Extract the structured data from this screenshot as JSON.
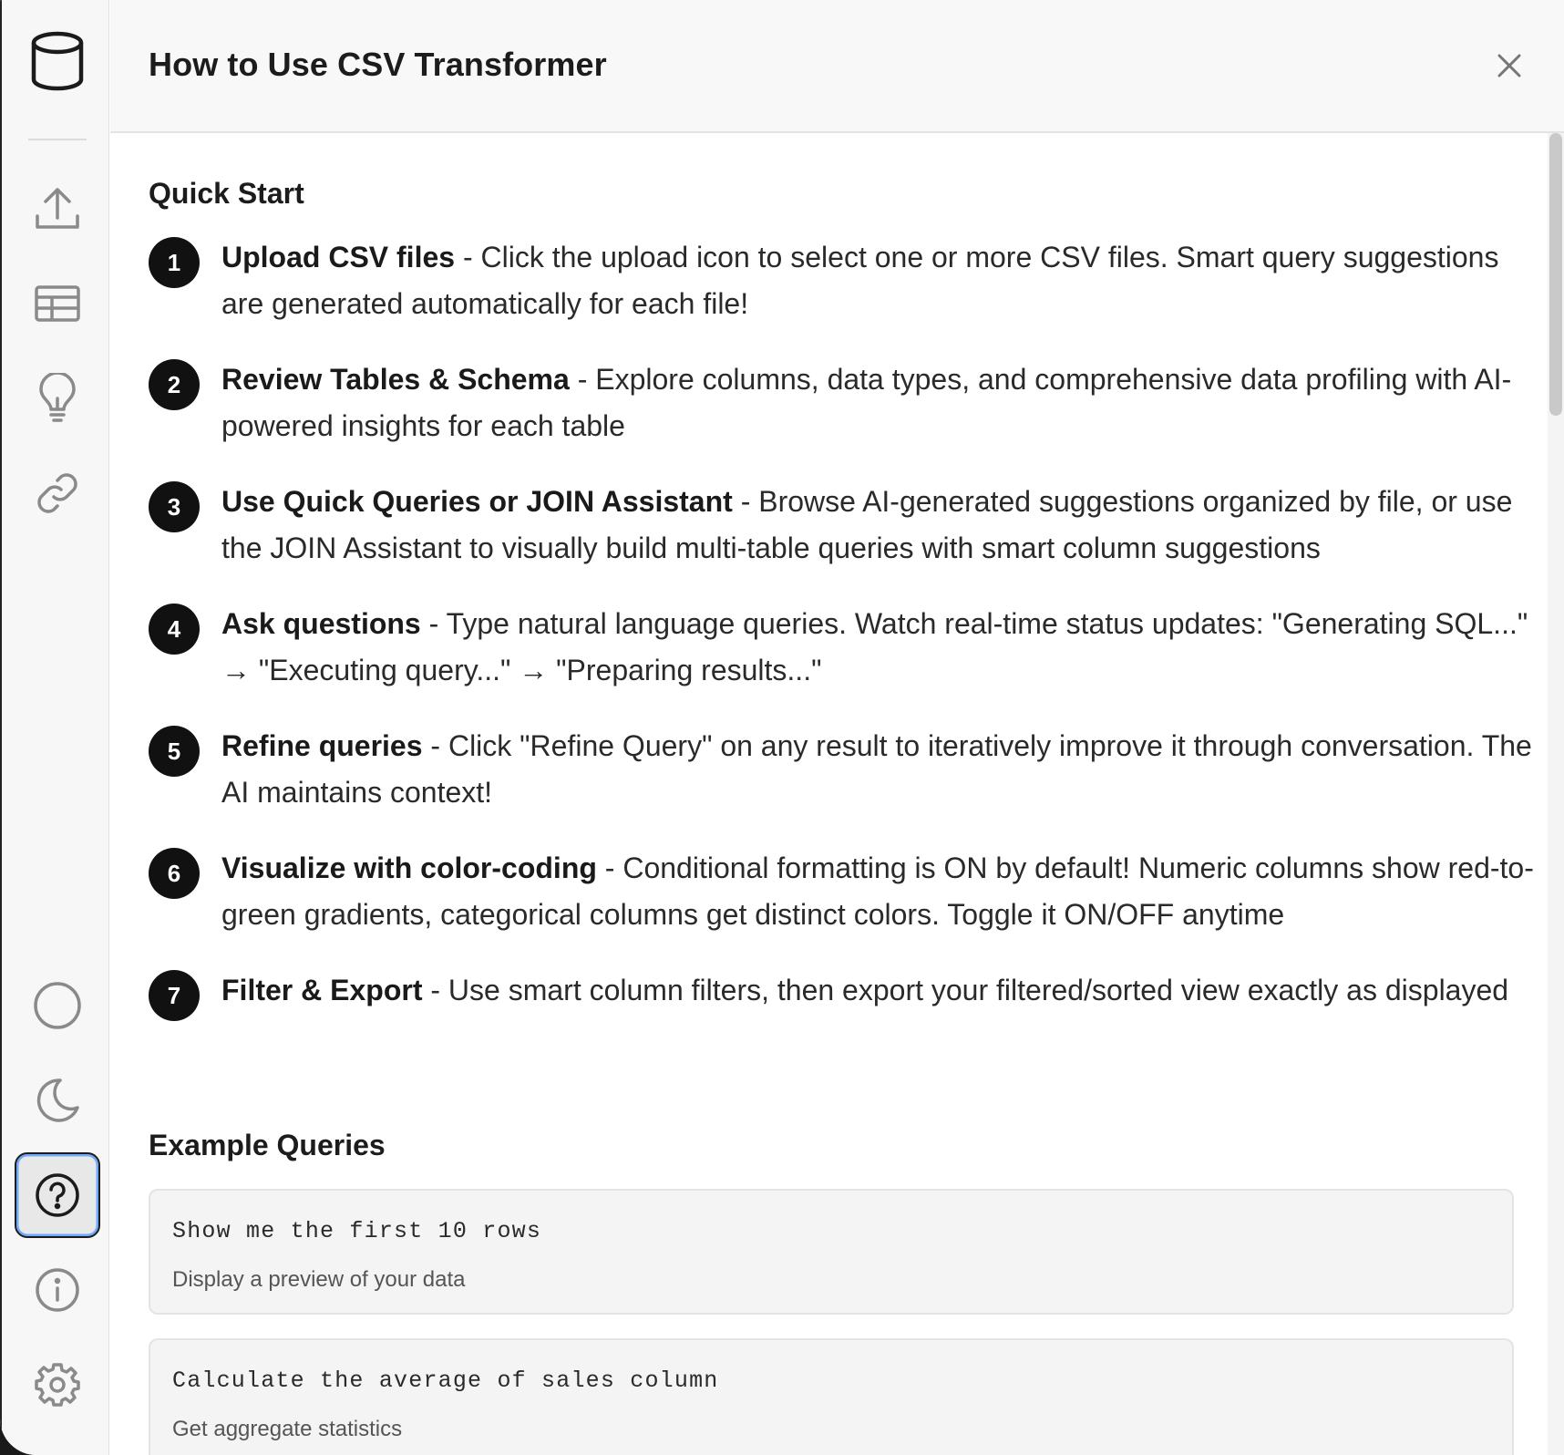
{
  "header": {
    "title": "How to Use CSV Transformer"
  },
  "sidebar": {
    "logo_icon": "database-icon",
    "items": [
      {
        "name": "upload-icon"
      },
      {
        "name": "table-icon"
      },
      {
        "name": "lightbulb-icon"
      },
      {
        "name": "link-icon"
      },
      {
        "name": "circle-icon"
      },
      {
        "name": "moon-icon"
      },
      {
        "name": "help-icon",
        "active": true
      },
      {
        "name": "info-icon"
      },
      {
        "name": "gear-icon"
      }
    ]
  },
  "quick_start": {
    "title": "Quick Start",
    "steps": [
      {
        "num": "1",
        "bold": "Upload CSV files",
        "text": " - Click the upload icon to select one or more CSV files. Smart query suggestions are generated automatically for each file!"
      },
      {
        "num": "2",
        "bold": "Review Tables & Schema",
        "text": " - Explore columns, data types, and comprehensive data profiling with AI-powered insights for each table"
      },
      {
        "num": "3",
        "bold": "Use Quick Queries or JOIN Assistant",
        "text": " - Browse AI-generated suggestions organized by file, or use the JOIN Assistant to visually build multi-table queries with smart column suggestions"
      },
      {
        "num": "4",
        "bold": "Ask questions",
        "text": " - Type natural language queries. Watch real-time status updates: \"Generating SQL...\" → \"Executing query...\" → \"Preparing results...\""
      },
      {
        "num": "5",
        "bold": "Refine queries",
        "text": " - Click \"Refine Query\" on any result to iteratively improve it through conversation. The AI maintains context!"
      },
      {
        "num": "6",
        "bold": "Visualize with color-coding",
        "text": " - Conditional formatting is ON by default! Numeric columns show red-to-green gradients, categorical columns get distinct colors. Toggle it ON/OFF anytime"
      },
      {
        "num": "7",
        "bold": "Filter & Export",
        "text": " - Use smart column filters, then export your filtered/sorted view exactly as displayed"
      }
    ]
  },
  "examples": {
    "title": "Example Queries",
    "items": [
      {
        "query": "Show me the first 10 rows",
        "desc": "Display a preview of your data"
      },
      {
        "query": "Calculate the average of sales column",
        "desc": "Get aggregate statistics"
      }
    ]
  }
}
